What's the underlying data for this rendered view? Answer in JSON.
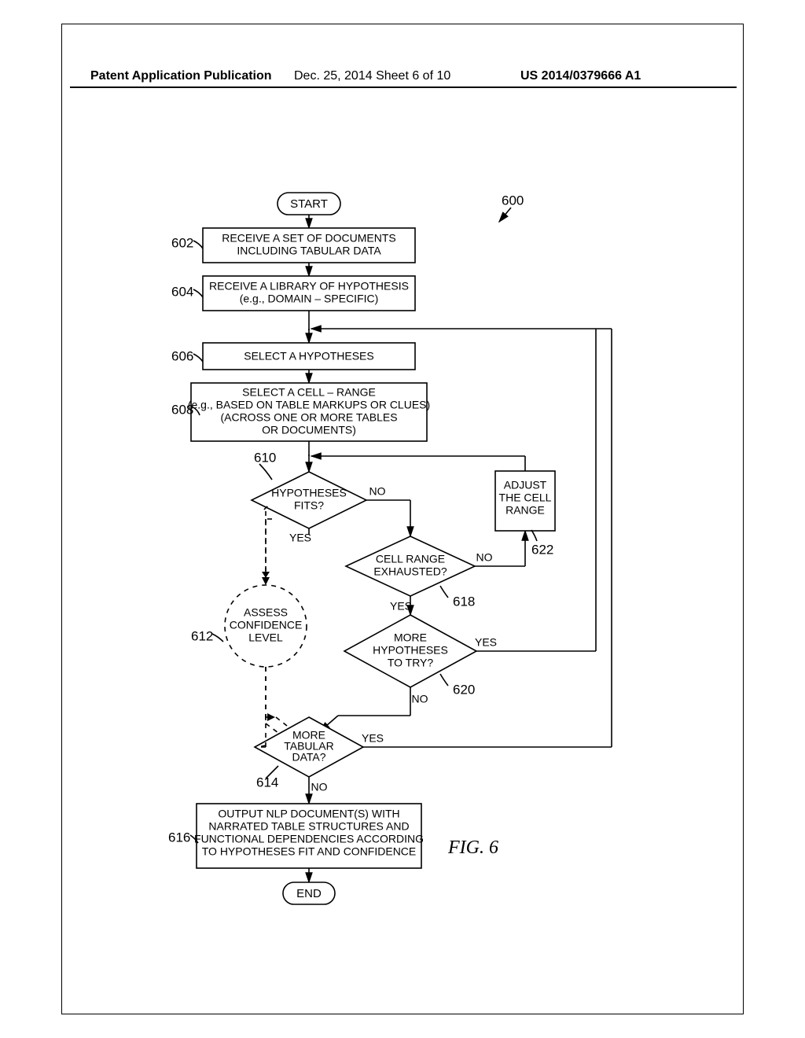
{
  "header": {
    "left": "Patent Application Publication",
    "center": "Dec. 25, 2014  Sheet 6 of 10",
    "right": "US 2014/0379666 A1"
  },
  "figure": {
    "label": "FIG. 6",
    "refnum_main": "600",
    "nodes": {
      "start": "START",
      "n602": "RECEIVE A SET OF DOCUMENTS\nINCLUDING TABULAR DATA",
      "n604": "RECEIVE A LIBRARY OF HYPOTHESIS\n(e.g., DOMAIN – SPECIFIC)",
      "n606": "SELECT A HYPOTHESES",
      "n608": "SELECT A CELL – RANGE\n(e.g., BASED ON TABLE MARKUPS OR CLUES)\n(ACROSS ONE OR MORE TABLES\nOR DOCUMENTS)",
      "n610": "HYPOTHESES\nFITS?",
      "n612": "ASSESS\nCONFIDENCE\nLEVEL",
      "n614": "MORE\nTABULAR\nDATA?",
      "n616": "OUTPUT NLP DOCUMENT(S) WITH\nNARRATED TABLE STRUCTURES AND\nFUNCTIONAL DEPENDENCIES ACCORDING\nTO HYPOTHESES FIT AND CONFIDENCE",
      "n618": "CELL RANGE\nEXHAUSTED?",
      "n620": "MORE\nHYPOTHESES\nTO TRY?",
      "n622": "ADJUST\nTHE CELL\nRANGE",
      "end": "END"
    },
    "edge_labels": {
      "yes": "YES",
      "no": "NO"
    },
    "refs": {
      "r602": "602",
      "r604": "604",
      "r606": "606",
      "r608": "608",
      "r610": "610",
      "r612": "612",
      "r614": "614",
      "r616": "616",
      "r618": "618",
      "r620": "620",
      "r622": "622"
    }
  }
}
